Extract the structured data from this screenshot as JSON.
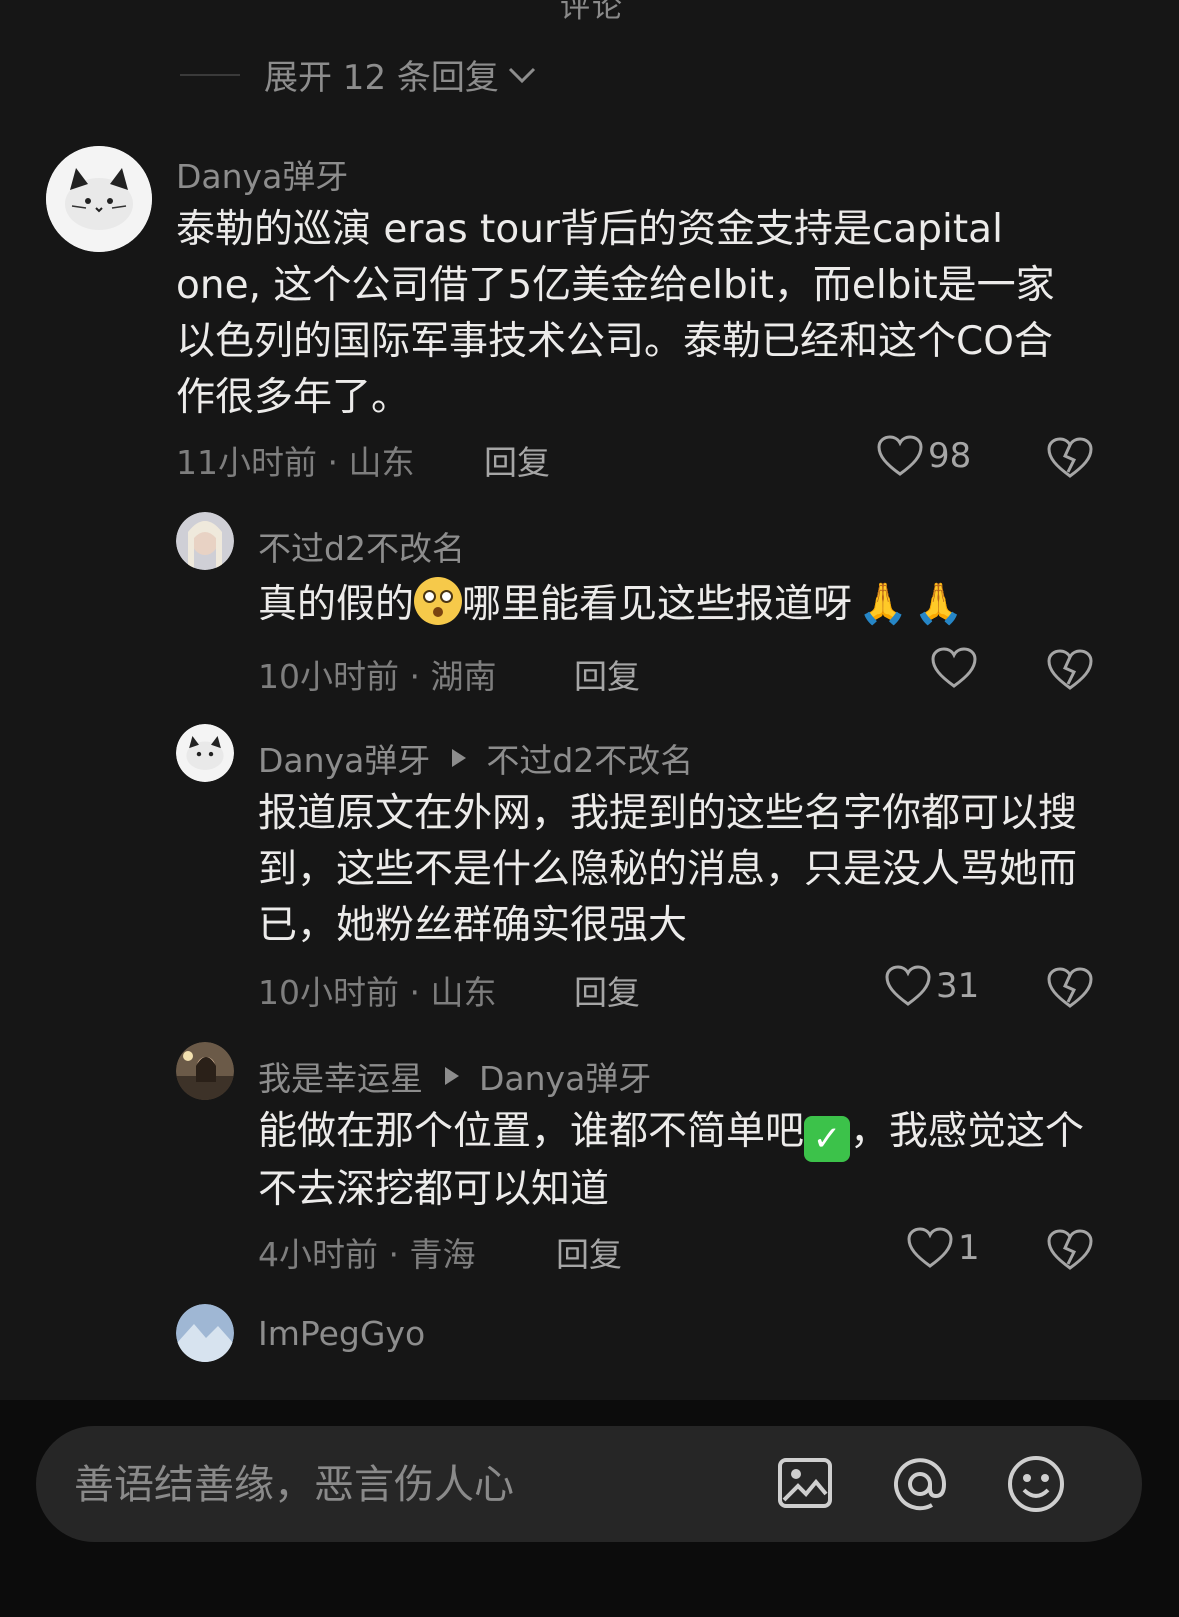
{
  "top_partial_text": "评论",
  "expand_replies": "展开 12 条回复",
  "comments": [
    {
      "username": "Danya弹牙",
      "text": "泰勒的巡演 eras tour背后的资金支持是capital one, 这个公司借了5亿美金给elbit，而elbit是一家以色列的国际军事技术公司。泰勒已经和这个CO合作很多年了。",
      "time_location": "11小时前 · 山东",
      "reply_label": "回复",
      "likes": "98"
    },
    {
      "username": "不过d2不改名",
      "text_before": "真的假的",
      "text_after": "哪里能看见这些报道呀",
      "time_location": "10小时前 · 湖南",
      "reply_label": "回复",
      "likes": ""
    },
    {
      "username": "Danya弹牙",
      "reply_to": "不过d2不改名",
      "text": "报道原文在外网，我提到的这些名字你都可以搜到，这些不是什么隐秘的消息，只是没人骂她而已，她粉丝群确实很强大",
      "time_location": "10小时前 · 山东",
      "reply_label": "回复",
      "likes": "31"
    },
    {
      "username": "我是幸运星",
      "reply_to": "Danya弹牙",
      "text_before": "能做在那个位置，谁都不简单吧",
      "text_after": "，我感觉这个不去深挖都可以知道",
      "time_location": "4小时前 · 青海",
      "reply_label": "回复",
      "likes": "1"
    },
    {
      "username": "ImPegGyo"
    }
  ],
  "input": {
    "placeholder": "善语结善缘，恶言伤人心"
  },
  "icons": {
    "image": "image-icon",
    "mention": "at-icon",
    "emoji": "smiley-icon",
    "like": "heart-icon",
    "dislike": "broken-heart-icon"
  }
}
